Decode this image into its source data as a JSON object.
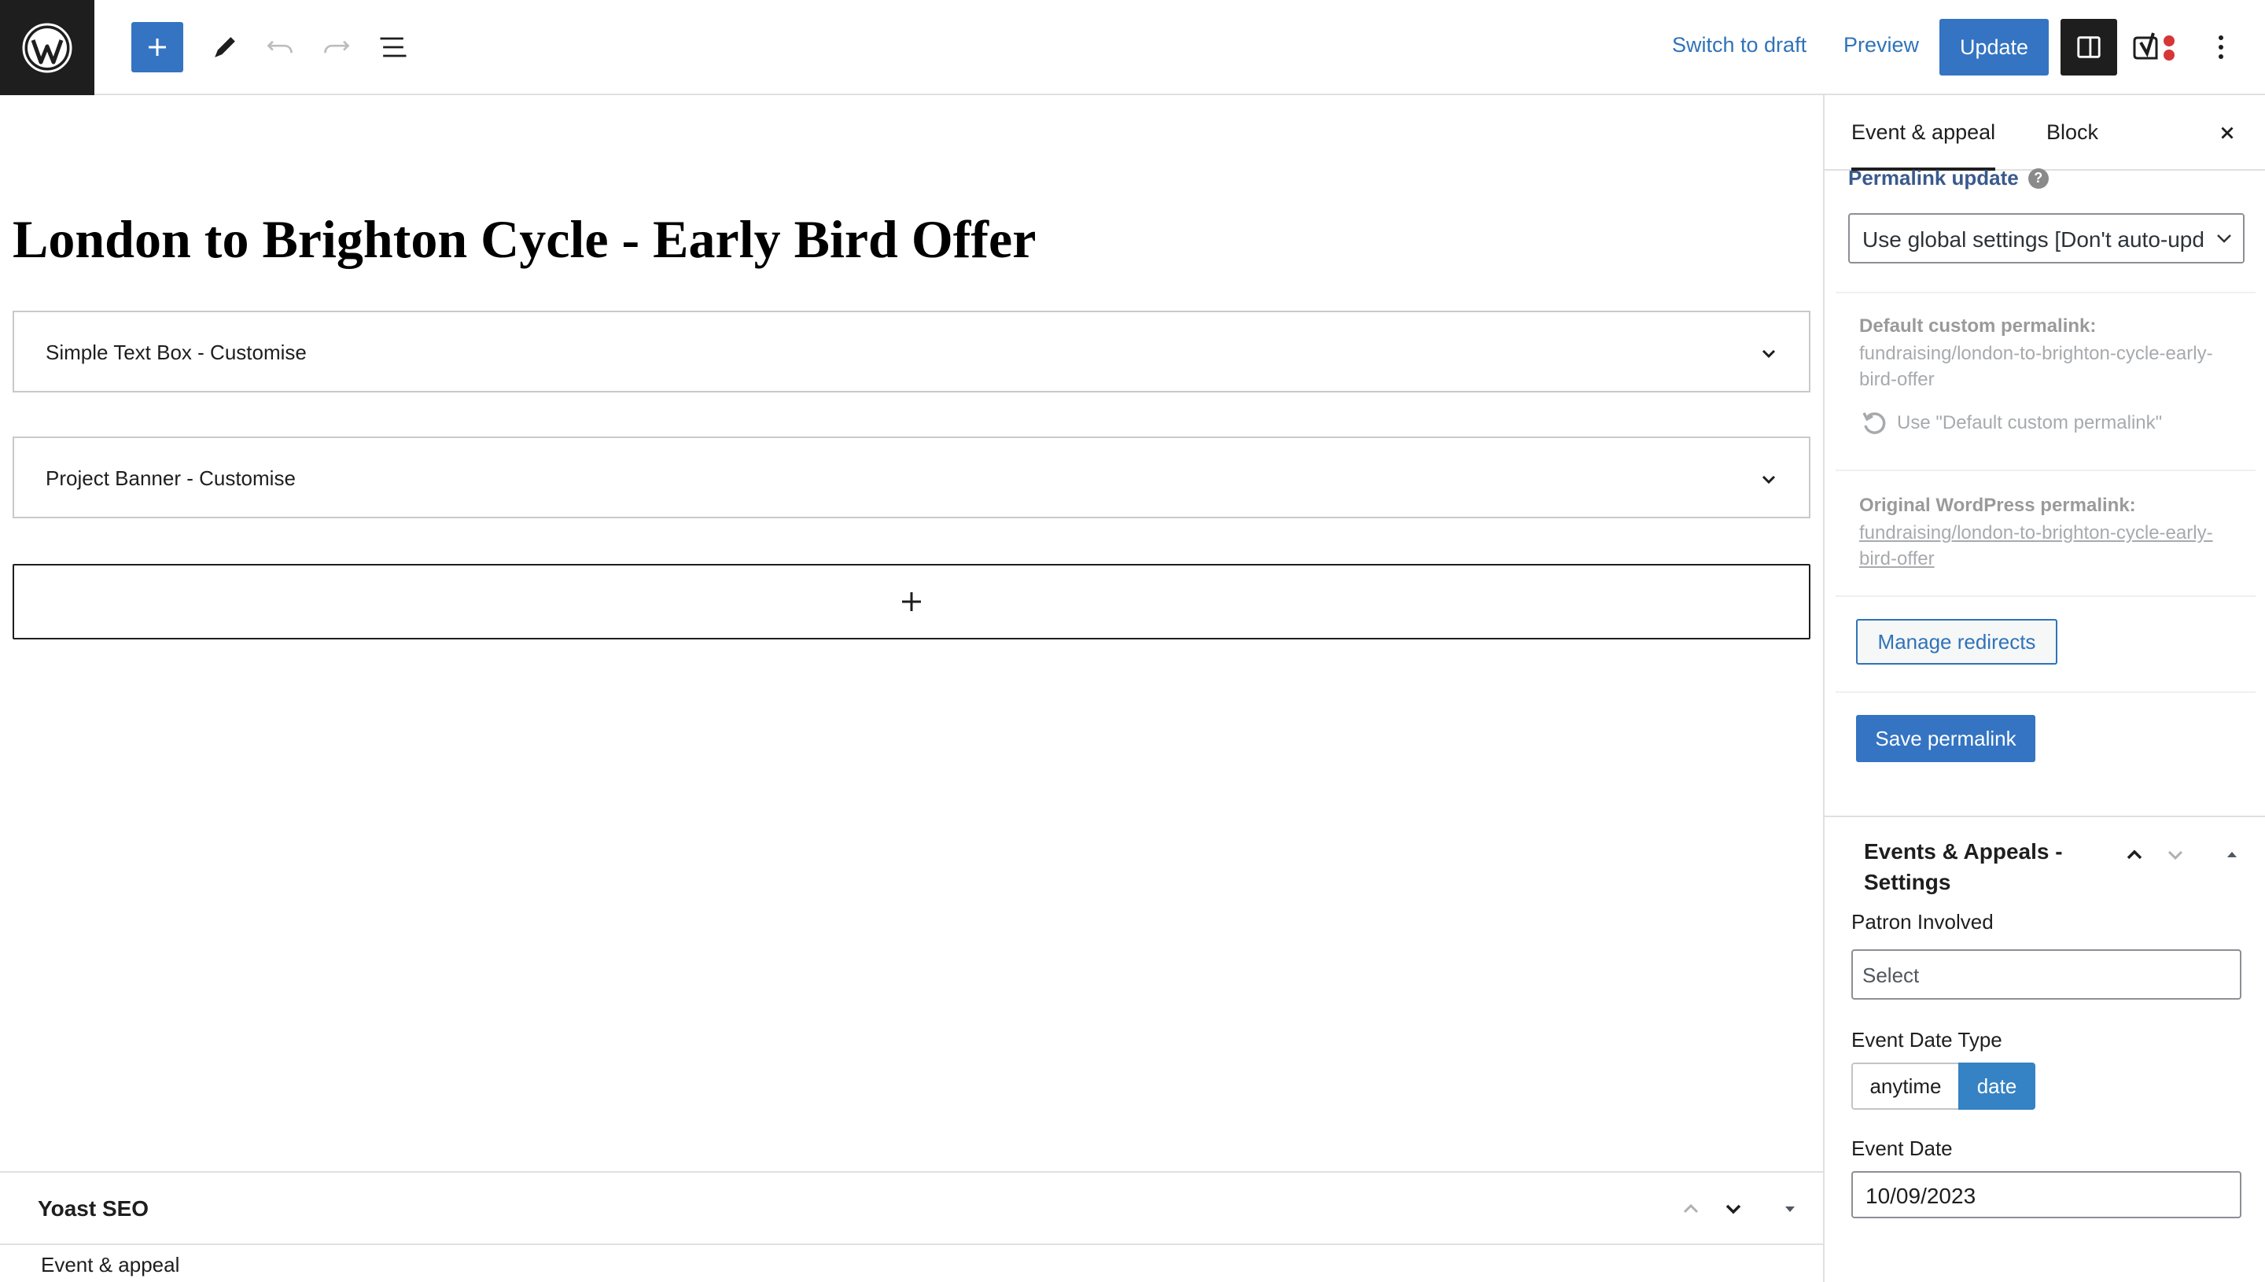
{
  "toolbar": {
    "switch_draft": "Switch to draft",
    "preview": "Preview",
    "update": "Update",
    "icons": [
      "wordpress-logo",
      "plus-icon",
      "pencil-icon",
      "undo-icon",
      "redo-icon",
      "list-view-icon",
      "sidebar-toggle-icon",
      "yoast-icon",
      "more-vertical-icon"
    ]
  },
  "editor": {
    "post_title": "London to Brighton Cycle - Early Bird Offer",
    "blocks": [
      {
        "label": "Simple Text Box - Customise"
      },
      {
        "label": "Project Banner - Customise"
      }
    ]
  },
  "meta_boxes": {
    "yoast_title": "Yoast SEO",
    "event_appeal_title": "Event & appeal"
  },
  "sidebar": {
    "tabs": [
      {
        "label": "Event & appeal",
        "active": true
      },
      {
        "label": "Block",
        "active": false
      }
    ],
    "permalink": {
      "update_label": "Permalink update",
      "help": "?",
      "select_value": "Use global settings [Don't auto-update]",
      "default_label": "Default custom permalink:",
      "default_value": "fundraising/london-to-brighton-cycle-early-bird-offer",
      "use_default": "Use \"Default custom permalink\"",
      "original_label": "Original WordPress permalink:",
      "original_value": "fundraising/london-to-brighton-cycle-early-bird-offer",
      "manage_redirects": "Manage redirects",
      "save_permalink": "Save permalink"
    },
    "events_panel": {
      "title": "Events & Appeals - Settings",
      "patron_label": "Patron Involved",
      "patron_placeholder": "Select",
      "date_type_label": "Event Date Type",
      "date_type_options": [
        "anytime",
        "date"
      ],
      "date_type_selected": "date",
      "date_label": "Event Date",
      "date_value": "10/09/2023"
    }
  },
  "colors": {
    "accent": "#3474c2",
    "dark": "#1e1e1e",
    "link": "#2f73b9"
  }
}
